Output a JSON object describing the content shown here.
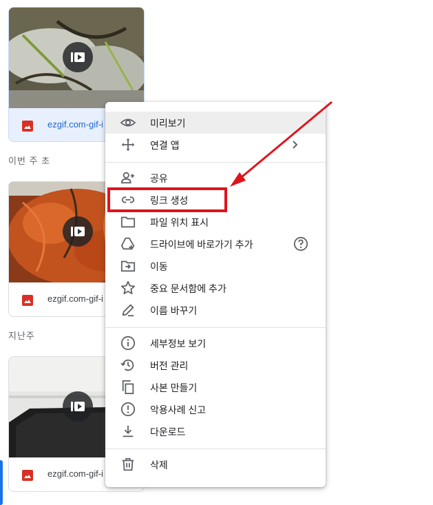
{
  "files": [
    {
      "name": "ezgif.com-gif-i",
      "selected": true
    },
    {
      "name": "ezgif.com-gif-i",
      "selected": false
    },
    {
      "name": "ezgif.com-gif-i",
      "selected": false
    }
  ],
  "sections": {
    "this_week": "이번 주 초",
    "last_week": "지난주"
  },
  "menu": {
    "preview": "미리보기",
    "open_with": "연결 앱",
    "share": "공유",
    "get_link": "링크 생성",
    "show_location": "파일 위치 표시",
    "add_shortcut": "드라이브에 바로가기 추가",
    "move": "이동",
    "add_starred": "중요 문서함에 추가",
    "rename": "이름 바꾸기",
    "details": "세부정보 보기",
    "versions": "버전 관리",
    "copy": "사본 만들기",
    "report": "악용사례 신고",
    "download": "다운로드",
    "delete": "삭제"
  },
  "colors": {
    "annotation_red": "#e0131b",
    "file_icon_red": "#d93025",
    "selected_bg": "#e8f0fe"
  }
}
